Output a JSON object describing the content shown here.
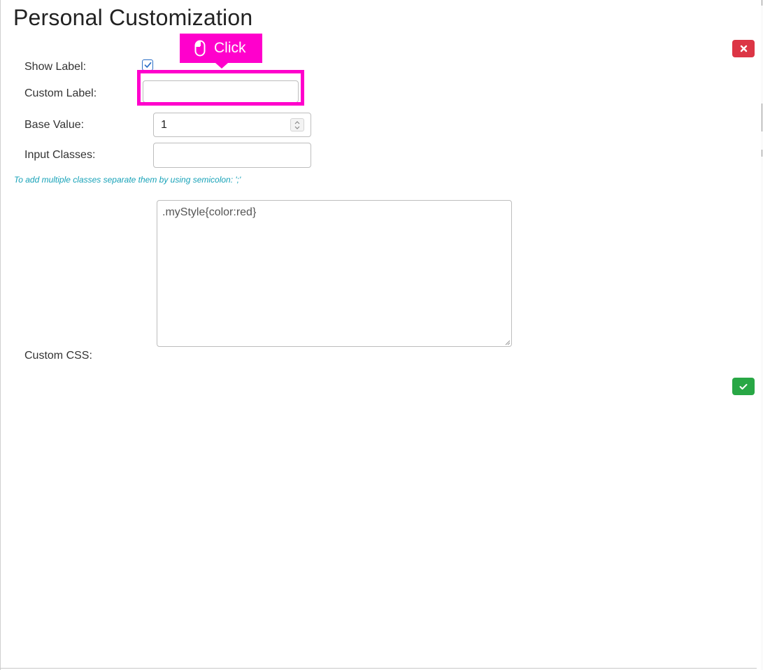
{
  "dialog": {
    "title": "Personal Customization",
    "close_icon": "close-icon",
    "confirm_icon": "check-icon"
  },
  "form": {
    "show_label": {
      "label": "Show Label:",
      "checked": true
    },
    "custom_label": {
      "label": "Custom Label:",
      "value": ""
    },
    "base_value": {
      "label": "Base Value:",
      "value": "1"
    },
    "input_classes": {
      "label": "Input Classes:",
      "value": ""
    },
    "hint": "To add multiple classes separate them by using semicolon: ';'",
    "custom_css": {
      "label": "Custom CSS:",
      "value": ".myStyle{color:red}"
    }
  },
  "annotation": {
    "label": "Click",
    "icon": "mouse-icon"
  },
  "colors": {
    "close_button": "#dc3545",
    "confirm_button": "#28a745",
    "hint_text": "#17a2b8",
    "annotation": "#ff00cc",
    "checkbox": "#2a6ec6"
  }
}
